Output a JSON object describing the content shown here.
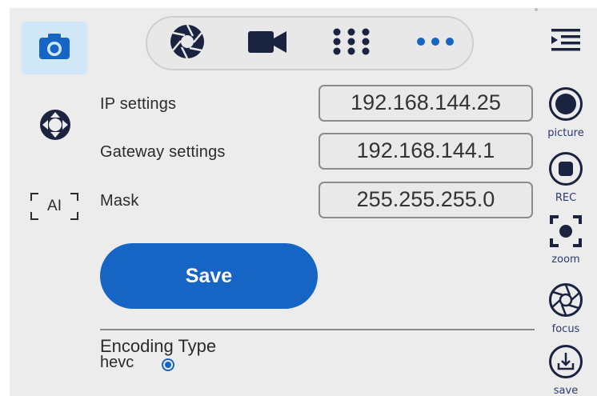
{
  "left_sidebar": {
    "photo_mode_icon": "camera-icon",
    "ptz_icon": "ptz-control-icon",
    "ai_label": "AI"
  },
  "mode_bar": {
    "items": [
      "aperture-icon",
      "video-camera-icon",
      "grid-icon",
      "more-icon"
    ],
    "active": "more-icon"
  },
  "form": {
    "ip_label": "IP settings",
    "ip_value": "192.168.144.25",
    "gateway_label": "Gateway settings",
    "gateway_value": "192.168.144.1",
    "mask_label": "Mask",
    "mask_value": "255.255.255.0",
    "save_label": "Save"
  },
  "encoding": {
    "title": "Encoding Type",
    "option_label": "hevc",
    "selected": true
  },
  "right_sidebar": {
    "menu_icon": "menu-collapse-icon",
    "picture_label": "picture",
    "rec_label": "REC",
    "zoom_label": "zoom",
    "focus_label": "focus",
    "save_label": "save"
  },
  "colors": {
    "accent": "#1664c4",
    "active_tile": "#cfe7f6",
    "background": "#ececec",
    "icon_dark": "#1a2340"
  }
}
